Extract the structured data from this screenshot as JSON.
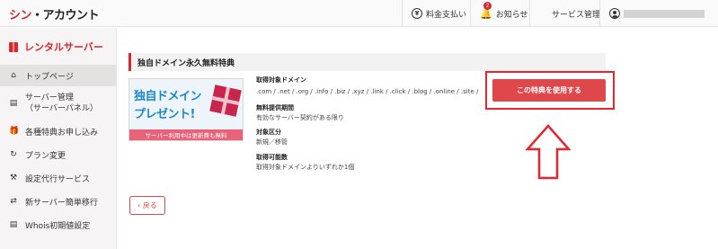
{
  "header": {
    "logo_main": "シン",
    "logo_sub": "・アカウント",
    "items": [
      {
        "label": "料金支払い",
        "icon": "yen-icon"
      },
      {
        "label": "お知らせ",
        "icon": "bell-icon",
        "badge": "2"
      },
      {
        "label": "サービス管理",
        "icon": "grid-icon"
      }
    ],
    "user_icon": "user-icon"
  },
  "sidebar": {
    "title": "レンタルサーバー",
    "items": [
      {
        "label": "トップページ",
        "icon": "home-icon",
        "active": true
      },
      {
        "label": "サーバー管理",
        "sub": "（サーバーパネル）",
        "icon": "server-icon"
      },
      {
        "label": "各種特典お申し込み",
        "icon": "gift-icon"
      },
      {
        "label": "プラン変更",
        "icon": "refresh-icon"
      },
      {
        "label": "設定代行サービス",
        "icon": "wrench-icon"
      },
      {
        "label": "新サーバー簡単移行",
        "icon": "transfer-icon"
      },
      {
        "label": "Whois初期値設定",
        "icon": "document-icon"
      }
    ]
  },
  "main": {
    "section_title": "独自ドメイン永久無料特典",
    "banner": {
      "line1": "独自ドメイン",
      "line2": "プレゼント!",
      "footer": "サーバー利用中は更新費も無料"
    },
    "details": [
      {
        "heading": "取得対象ドメイン",
        "value": ".com / .net / .org / .info / .biz / .xyz / .link / .click / .blog / .online / .site /"
      },
      {
        "heading": "無料提供期間",
        "value": "有効なサーバー契約がある限り"
      },
      {
        "heading": "対象区分",
        "value": "新規／移管"
      },
      {
        "heading": "取得可能数",
        "value": "取得対象ドメインよりいずれか1個"
      }
    ],
    "use_button": "この特典を使用する",
    "back_button": "‹ 戻る"
  },
  "colors": {
    "accent": "#d9272e",
    "button": "#e0474b",
    "banner_blue": "#1c87c9"
  }
}
